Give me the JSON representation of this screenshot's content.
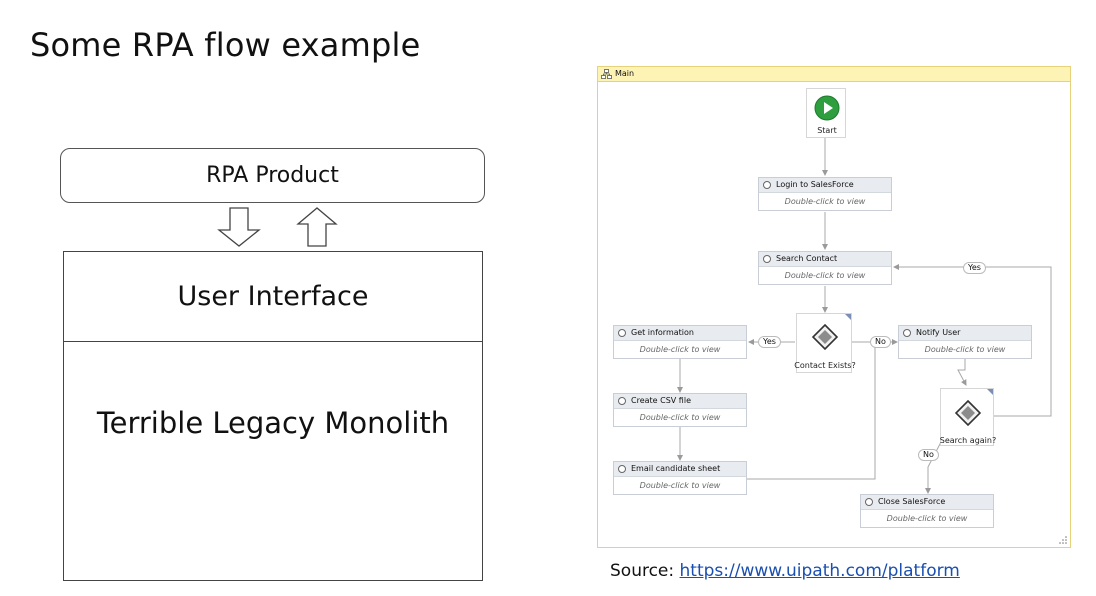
{
  "slide": {
    "title": "Some RPA flow example",
    "rpa_product": "RPA Product",
    "user_interface": "User Interface",
    "monolith": "Terrible Legacy Monolith",
    "source_label": "Source:",
    "source_link": "https://www.uipath.com/platform"
  },
  "workflow": {
    "panel_title": "Main",
    "start_label": "Start",
    "activities": {
      "login": {
        "title": "Login to SalesForce",
        "hint": "Double-click to view"
      },
      "search": {
        "title": "Search Contact",
        "hint": "Double-click to view"
      },
      "get_info": {
        "title": "Get information",
        "hint": "Double-click to view"
      },
      "notify": {
        "title": "Notify User",
        "hint": "Double-click to view"
      },
      "csv": {
        "title": "Create CSV file",
        "hint": "Double-click to view"
      },
      "email": {
        "title": "Email candidate sheet",
        "hint": "Double-click to view"
      },
      "close": {
        "title": "Close SalesForce",
        "hint": "Double-click to view"
      }
    },
    "decisions": {
      "contact_exists": "Contact Exists?",
      "search_again": "Search again?"
    },
    "edge_labels": {
      "yes_left": "Yes",
      "no_right": "No",
      "yes_loop": "Yes",
      "no_down": "No"
    },
    "colors": {
      "panel_border": "#e6d27a",
      "panel_header": "#fdf3b5",
      "start_green": "#2e9e3e"
    }
  }
}
